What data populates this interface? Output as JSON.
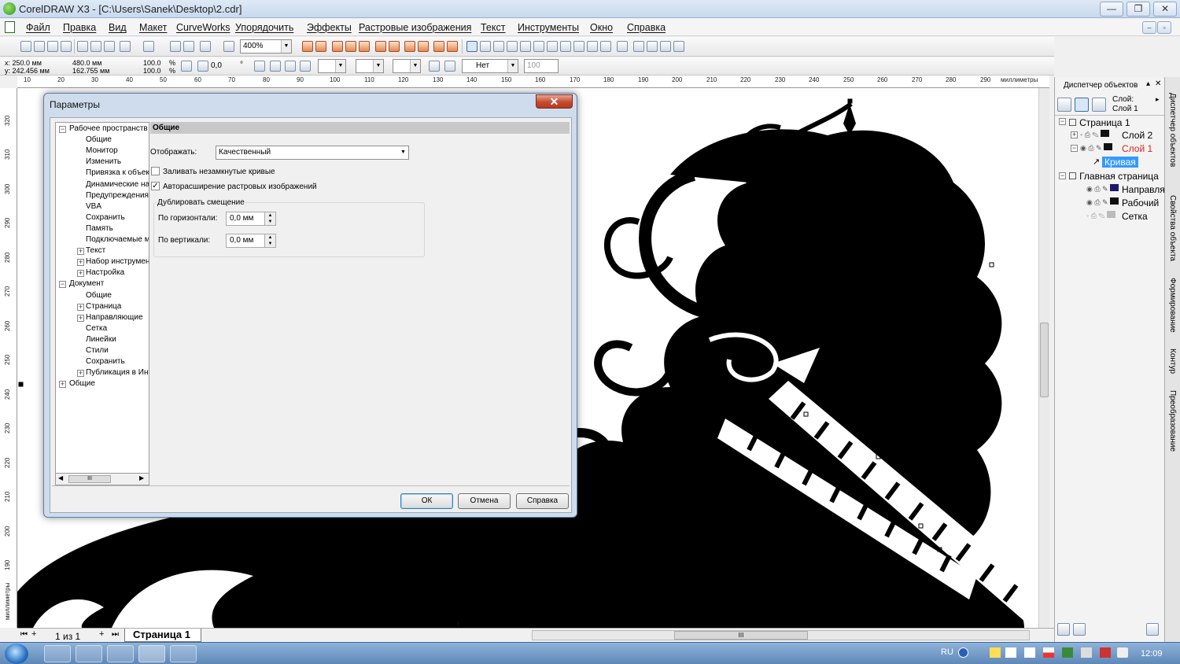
{
  "window": {
    "title": "CorelDRAW X3 - [C:\\Users\\Sanek\\Desktop\\2.cdr]"
  },
  "menu": [
    "Файл",
    "Правка",
    "Вид",
    "Макет",
    "CurveWorks",
    "Упорядочить",
    "Эффекты",
    "Растровые изображения",
    "Текст",
    "Инструменты",
    "Окно",
    "Справка"
  ],
  "toolbar": {
    "zoom": "400%",
    "outline_label": "Нет",
    "opacity": "100"
  },
  "props": {
    "x": "x: 250.0 мм",
    "y": "y: 242.456 мм",
    "w": "480.0 мм",
    "h": "162.755 мм",
    "scale_x": "100.0",
    "scale_y": "100.0",
    "pct": "%",
    "angle": "0,0",
    "deg": "°"
  },
  "ruler": {
    "h_ticks": [
      "10",
      "20",
      "30",
      "40",
      "50",
      "60",
      "70",
      "80",
      "90",
      "100",
      "110",
      "120",
      "130",
      "140",
      "150",
      "160",
      "170",
      "180",
      "190",
      "200",
      "210",
      "220",
      "230",
      "240",
      "250",
      "260",
      "270",
      "280",
      "290"
    ],
    "h_unit": "миллиметры",
    "v_ticks": [
      "320",
      "310",
      "300",
      "290",
      "280",
      "270",
      "260",
      "250",
      "240",
      "230",
      "220",
      "210",
      "200",
      "190"
    ],
    "v_unit": "миллиметры"
  },
  "pagebar": {
    "counter": "1 из 1",
    "page_tab": "Страница 1"
  },
  "docker": {
    "title": "Диспетчер объектов",
    "layer_label": "Слой:",
    "layer_value": "Слой 1",
    "tree": [
      "Страница 1",
      "Слой 2",
      "Слой 1",
      "Кривая",
      "Главная страница",
      "Направля",
      "Рабочий",
      "Сетка"
    ],
    "side_tabs": [
      "Диспетчер объектов",
      "Свойства объекта",
      "Формирование",
      "Контур",
      "Преобразование"
    ]
  },
  "dialog": {
    "title": "Параметры",
    "tree": [
      {
        "label": "Рабочее пространств",
        "level": 0,
        "box": "−"
      },
      {
        "label": "Общие",
        "level": 1
      },
      {
        "label": "Монитор",
        "level": 1
      },
      {
        "label": "Изменить",
        "level": 1
      },
      {
        "label": "Привязка к объек",
        "level": 1
      },
      {
        "label": "Динамические на",
        "level": 1
      },
      {
        "label": "Предупреждения",
        "level": 1
      },
      {
        "label": "VBA",
        "level": 1
      },
      {
        "label": "Сохранить",
        "level": 1
      },
      {
        "label": "Память",
        "level": 1
      },
      {
        "label": "Подключаемые м",
        "level": 1
      },
      {
        "label": "Текст",
        "level": 1,
        "box": "+"
      },
      {
        "label": "Набор инструмент",
        "level": 1,
        "box": "+"
      },
      {
        "label": "Настройка",
        "level": 1,
        "box": "+"
      },
      {
        "label": "Документ",
        "level": 0,
        "box": "−"
      },
      {
        "label": "Общие",
        "level": 1
      },
      {
        "label": "Страница",
        "level": 1,
        "box": "+"
      },
      {
        "label": "Направляющие",
        "level": 1,
        "box": "+"
      },
      {
        "label": "Сетка",
        "level": 1
      },
      {
        "label": "Линейки",
        "level": 1
      },
      {
        "label": "Стили",
        "level": 1
      },
      {
        "label": "Сохранить",
        "level": 1
      },
      {
        "label": "Публикация в Инт",
        "level": 1,
        "box": "+"
      },
      {
        "label": "Общие",
        "level": 0,
        "box": "+"
      }
    ],
    "panel_title": "Общие",
    "display_label": "Отображать:",
    "display_value": "Качественный",
    "fill_open": "Заливать незамкнутые кривые",
    "auto_expand": "Авторасширение растровых изображений",
    "offset_group": "Дублировать смещение",
    "horiz_label": "По горизонтали:",
    "horiz_value": "0,0 мм",
    "vert_label": "По вертикали:",
    "vert_value": "0,0 мм",
    "ok": "ОК",
    "cancel": "Отмена",
    "help": "Справка",
    "scroll_grip": "III"
  },
  "hscroll_grip": "III",
  "taskbar": {
    "lang": "RU",
    "time": "12:09"
  }
}
